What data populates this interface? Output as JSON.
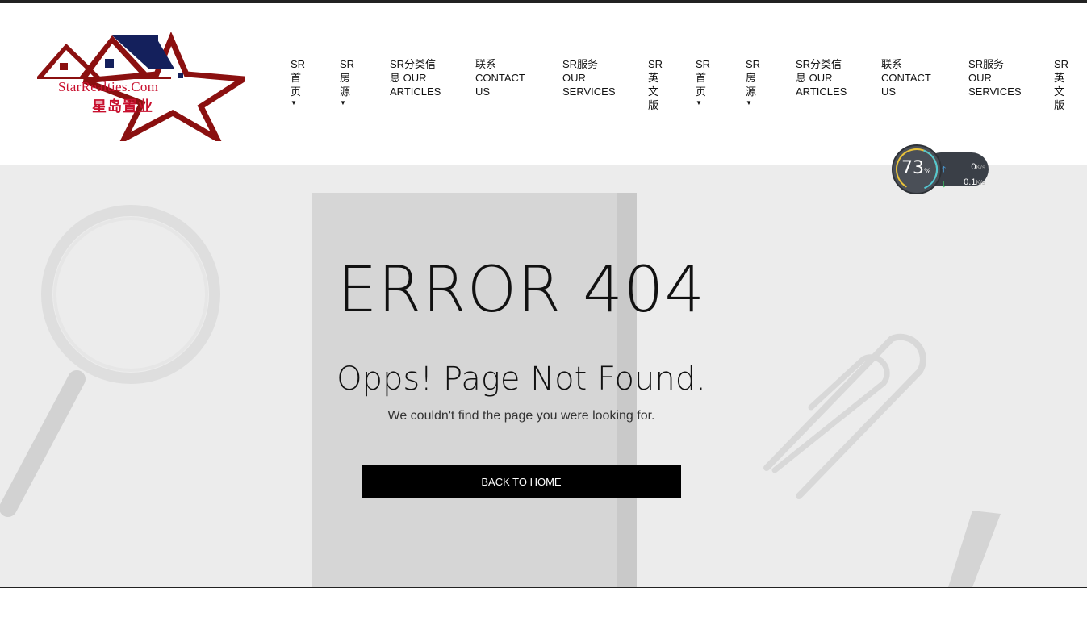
{
  "logo": {
    "text_en": "StarRealties.Com",
    "text_cn": "星岛置业",
    "brand_red": "#8b1010",
    "brand_navy": "#14205c"
  },
  "nav": {
    "items": [
      {
        "label": "SR\n首\n页",
        "has_dropdown": true
      },
      {
        "label": "SR\n房\n源",
        "has_dropdown": true
      },
      {
        "label": "SR分类信\n息 OUR\nARTICLES",
        "has_dropdown": false
      },
      {
        "label": "联系\nCONTACT\nUS",
        "has_dropdown": false
      },
      {
        "label": "SR服务\nOUR\nSERVICES",
        "has_dropdown": false
      },
      {
        "label": "SR\n英\n文\n版",
        "has_dropdown": false
      },
      {
        "label": "SR\n首\n页",
        "has_dropdown": true
      },
      {
        "label": "SR\n房\n源",
        "has_dropdown": true
      },
      {
        "label": "SR分类信\n息 OUR\nARTICLES",
        "has_dropdown": false
      },
      {
        "label": "联系\nCONTACT\nUS",
        "has_dropdown": false
      },
      {
        "label": "SR服务\nOUR\nSERVICES",
        "has_dropdown": false
      },
      {
        "label": "SR\n英\n文\n版",
        "has_dropdown": false
      }
    ],
    "caret_icon": "caret-down-icon"
  },
  "hero": {
    "title": "ERROR 404",
    "subtitle": "Opps! Page Not Found.",
    "description": "We couldn't find the page you were looking for.",
    "button_label": "BACK TO HOME"
  },
  "speed_widget": {
    "percent": "73",
    "percent_unit": "%",
    "upload_value": "0",
    "download_value": "0.1",
    "rate_unit": "K/s"
  }
}
